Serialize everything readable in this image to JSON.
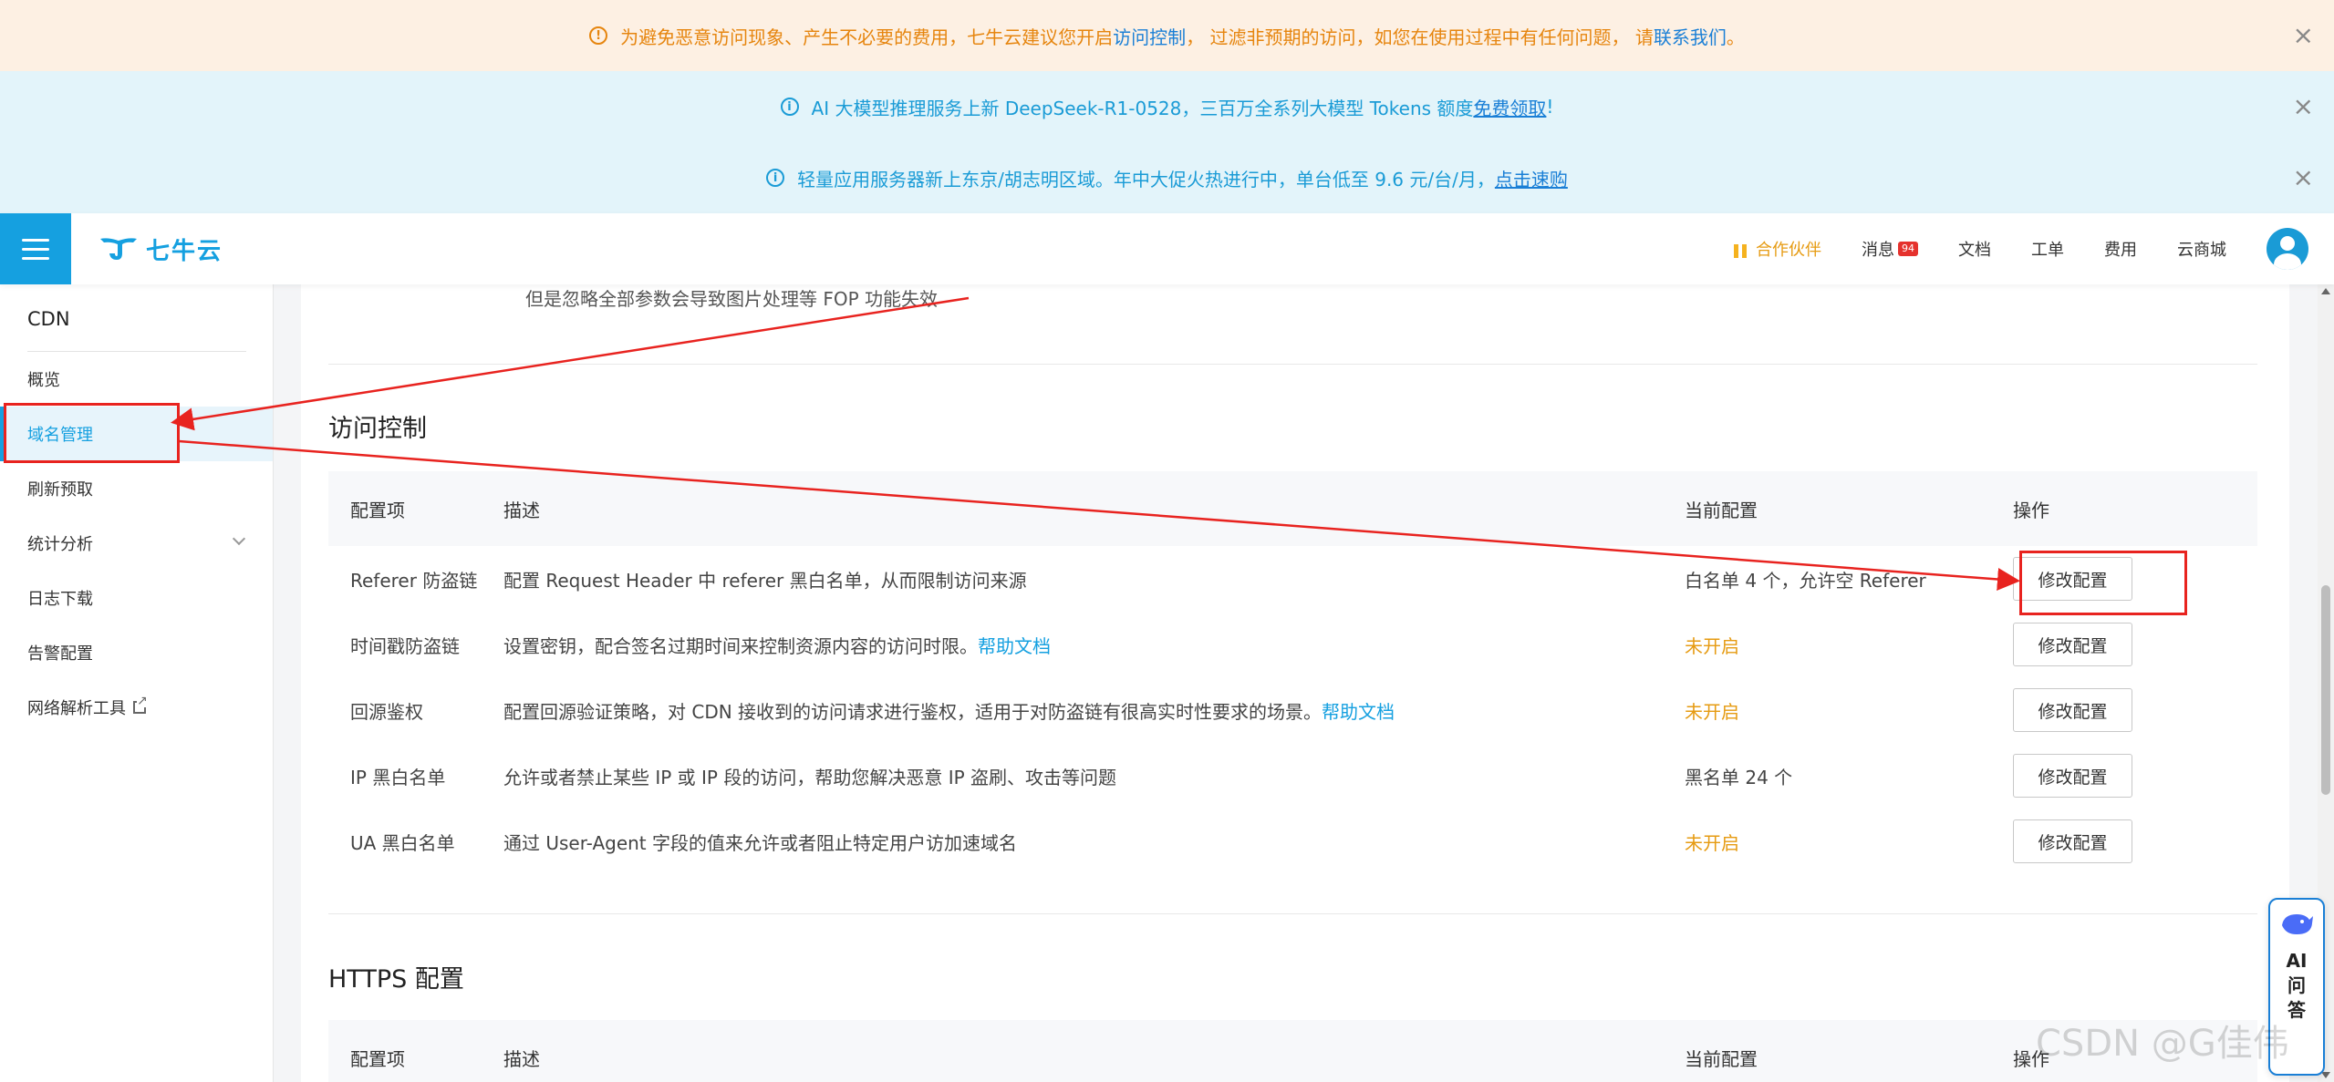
{
  "banners": [
    {
      "icon": "info-icon",
      "text_before": "为避免恶意访问现象、产生不必要的费用，七牛云建议您开启",
      "link": "访问控制",
      "text_middle": "， 过滤非预期的访问，如您在使用过程中有任何问题， 请",
      "link2": "联系我们",
      "text_after": "。"
    },
    {
      "icon": "info-icon",
      "text_before": "AI 大模型推理服务上新 DeepSeek-R1-0528，三百万全系列大模型 Tokens 额度",
      "link": "免费领取",
      "text_after": "!"
    },
    {
      "icon": "info-icon",
      "text_before": "轻量应用服务器新上东京/胡志明区域。年中大促火热进行中，单台低至 9.6 元/台/月，",
      "link": "点击速购"
    }
  ],
  "header": {
    "logo_text": "七牛云",
    "partner": "合作伙伴",
    "messages": "消息",
    "messages_badge": "94",
    "docs": "文档",
    "tickets": "工单",
    "billing": "费用",
    "marketplace": "云商城"
  },
  "sidebar": {
    "title": "CDN",
    "items": [
      {
        "label": "概览"
      },
      {
        "label": "域名管理"
      },
      {
        "label": "刷新预取"
      },
      {
        "label": "统计分析"
      },
      {
        "label": "日志下载"
      },
      {
        "label": "告警配置"
      },
      {
        "label": "网络解析工具"
      }
    ]
  },
  "main": {
    "prev_text": "但是忽略全部参数会导致图片处理等 FOP 功能失效",
    "access_section": {
      "title": "访问控制",
      "columns": [
        "配置项",
        "描述",
        "当前配置",
        "操作"
      ],
      "rows": [
        {
          "name": "Referer 防盗链",
          "desc": "配置 Request Header 中 referer 黑白名单，从而限制访问来源",
          "help": "",
          "state": "白名单 4 个，允许空 Referer",
          "action": "修改配置"
        },
        {
          "name": "时间戳防盗链",
          "desc": "设置密钥，配合签名过期时间来控制资源内容的访问时限。",
          "help": "帮助文档",
          "state": "未开启",
          "action": "修改配置"
        },
        {
          "name": "回源鉴权",
          "desc": "配置回源验证策略，对 CDN 接收到的访问请求进行鉴权，适用于对防盗链有很高实时性要求的场景。",
          "help": "帮助文档",
          "state": "未开启",
          "action": "修改配置"
        },
        {
          "name": "IP 黑白名单",
          "desc": "允许或者禁止某些 IP 或 IP 段的访问，帮助您解决恶意 IP 盗刷、攻击等问题",
          "help": "",
          "state": "黑名单 24 个",
          "action": "修改配置"
        },
        {
          "name": "UA 黑白名单",
          "desc": "通过 User-Agent 字段的值来允许或者阻止特定用户访加速域名",
          "help": "",
          "state": "未开启",
          "action": "修改配置"
        }
      ]
    },
    "https_section": {
      "title": "HTTPS 配置",
      "columns": [
        "配置项",
        "描述",
        "当前配置",
        "操作"
      ]
    }
  },
  "ai_widget": {
    "text": "AI问答"
  },
  "watermark": "CSDN @G佳伟",
  "colors": {
    "brand": "#15a0e0",
    "warning": "#e69b12",
    "annotation": "#e8231f"
  }
}
